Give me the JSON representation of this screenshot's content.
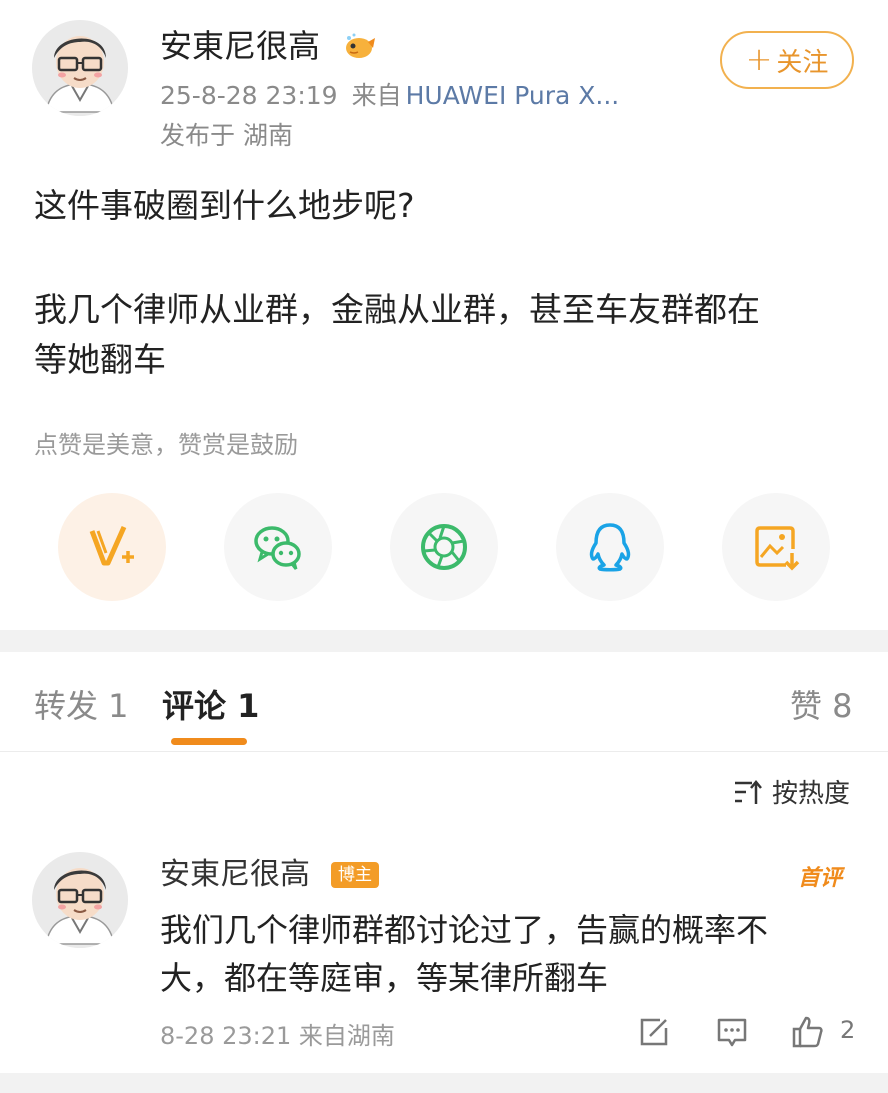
{
  "post": {
    "author": "安東尼很高",
    "timestamp": "25-8-28 23:19",
    "source_prefix": "来自",
    "device": "HUAWEI Pura X...",
    "location": "发布于 湖南",
    "follow_label": "关注",
    "follow_plus": "+",
    "lines": [
      "这件事破圈到什么地步呢?",
      "我几个律师从业群，金融从业群，甚至车友群都在",
      "等她翻车"
    ],
    "reward_tip": "点赞是美意，赞赏是鼓励"
  },
  "share_buttons": [
    {
      "name": "v-plus-icon",
      "color": "#f5a623"
    },
    {
      "name": "wechat-icon",
      "color": "#3cba6b"
    },
    {
      "name": "moments-icon",
      "color": "#3cba6b"
    },
    {
      "name": "qq-icon",
      "color": "#1aa3e6"
    },
    {
      "name": "save-image-icon",
      "color": "#f5a623"
    }
  ],
  "tabs": {
    "repost": "转发 1",
    "comment": "评论 1",
    "like": "赞 8"
  },
  "sort_label": "按热度",
  "comment": {
    "author": "安東尼很高",
    "tag": "博主",
    "first_badge": "首评",
    "lines": [
      "我们几个律师群都讨论过了，告赢的概率不",
      "大，都在等庭审，等某律所翻车"
    ],
    "meta": "8-28 23:21 来自湖南",
    "like_count": "2"
  },
  "colors": {
    "accent": "#f08b1c",
    "follow_border": "#f2b14f",
    "link": "#5c7aa6"
  }
}
